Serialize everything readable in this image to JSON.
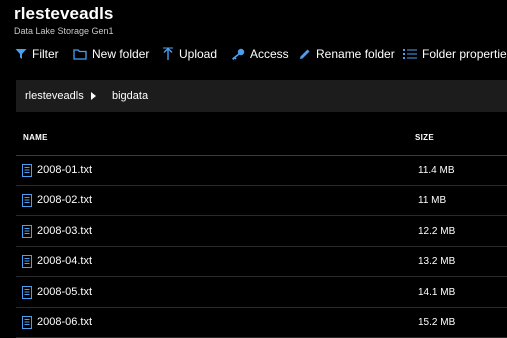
{
  "header": {
    "title": "rlesteveadls",
    "subtitle": "Data Lake Storage Gen1"
  },
  "toolbar": {
    "filter_label": "Filter",
    "new_folder_label": "New folder",
    "upload_label": "Upload",
    "access_label": "Access",
    "rename_folder_label": "Rename folder",
    "folder_properties_label": "Folder properties",
    "icon_color": "#4aa0f0"
  },
  "breadcrumb": {
    "items": [
      "rlesteveadls",
      "bigdata"
    ]
  },
  "table": {
    "columns": {
      "name": "NAME",
      "size": "SIZE"
    },
    "rows": [
      {
        "name": "2008-01.txt",
        "size": "11.4 MB",
        "icon": "file-icon"
      },
      {
        "name": "2008-02.txt",
        "size": "11 MB",
        "icon": "file-icon"
      },
      {
        "name": "2008-03.txt",
        "size": "12.2 MB",
        "icon": "file-icon"
      },
      {
        "name": "2008-04.txt",
        "size": "13.2 MB",
        "icon": "file-icon"
      },
      {
        "name": "2008-05.txt",
        "size": "14.1 MB",
        "icon": "file-icon"
      },
      {
        "name": "2008-06.txt",
        "size": "15.2 MB",
        "icon": "file-icon"
      }
    ]
  }
}
